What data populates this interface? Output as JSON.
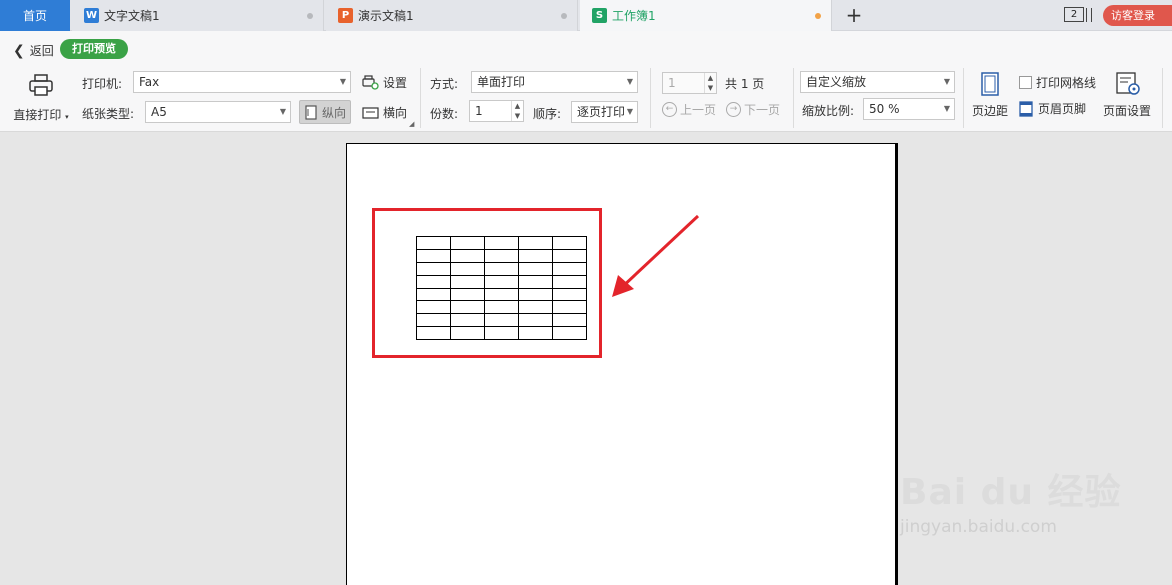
{
  "tabs": {
    "home": "首页",
    "items": [
      {
        "label": "文字文稿1",
        "icon": "W",
        "color": "#2f7dd6"
      },
      {
        "label": "演示文稿1",
        "icon": "P",
        "color": "#e8622c"
      },
      {
        "label": "工作簿1",
        "icon": "S",
        "color": "#21a366"
      }
    ],
    "window_count": "2",
    "login": "访客登录"
  },
  "toolbar": {
    "back": "返回",
    "mode": "打印预览",
    "direct_print": "直接打印",
    "printer_label": "打印机:",
    "printer_value": "Fax",
    "settings": "设置",
    "paper_label": "纸张类型:",
    "paper_value": "A5",
    "portrait": "纵向",
    "landscape": "横向",
    "method_label": "方式:",
    "method_value": "单面打印",
    "copies_label": "份数:",
    "copies_value": "1",
    "order_label": "顺序:",
    "order_value": "逐页打印",
    "page_value": "1",
    "total_pages": "共 1 页",
    "prev_page": "上一页",
    "next_page": "下一页",
    "zoom_mode": "自定义缩放",
    "zoom_label": "缩放比例:",
    "zoom_value": "50 %",
    "margins": "页边距",
    "print_gridlines": "打印网格线",
    "header_footer": "页眉页脚",
    "page_setup": "页面设置"
  },
  "watermark": {
    "brand": "Bai du 经验",
    "url": "jingyan.baidu.com"
  },
  "colors": {
    "accent_blue": "#2f7dd6",
    "preview_green": "#3aa246",
    "highlight_red": "#e3242b",
    "login_red": "#e0574c"
  },
  "preview_table": {
    "rows": 8,
    "cols": 5
  }
}
